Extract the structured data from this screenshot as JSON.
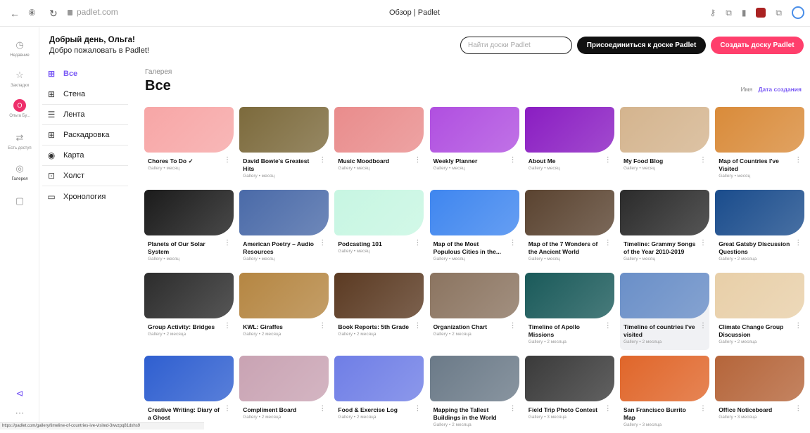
{
  "browser": {
    "url": "padlet.com",
    "window_title": "Обзор | Padlet",
    "status_url": "https://padlet.com/gallery/timeline-of-countries-ive-visited-3wvzpq81dxhs9"
  },
  "rail": {
    "items": [
      {
        "label": "Недавние",
        "icon": "clock-icon"
      },
      {
        "label": "Закладки",
        "icon": "star-icon"
      },
      {
        "label": "Ольга Бу...",
        "icon": "avatar",
        "avatar_letter": "О"
      },
      {
        "label": "Есть доступ",
        "icon": "share-icon"
      },
      {
        "label": "Галерея",
        "icon": "gallery-icon"
      },
      {
        "label": "",
        "icon": "add-board-icon"
      }
    ]
  },
  "greeting": {
    "title": "Добрый день, Ольга!",
    "subtitle": "Добро пожаловать в Padlet!"
  },
  "header": {
    "search_placeholder": "Найти доски Padlet",
    "join_label": "Присоединиться к доске Padlet",
    "create_label": "Создать доску Padlet"
  },
  "categories": [
    {
      "label": "Все",
      "icon": "grid-icon",
      "active": true
    },
    {
      "label": "Стена",
      "icon": "wall-icon"
    },
    {
      "label": "Лента",
      "icon": "stream-icon"
    },
    {
      "label": "Раскадровка",
      "icon": "storyboard-icon"
    },
    {
      "label": "Карта",
      "icon": "map-pin-icon"
    },
    {
      "label": "Холст",
      "icon": "canvas-icon"
    },
    {
      "label": "Хронология",
      "icon": "timeline-icon"
    }
  ],
  "gallery": {
    "breadcrumb": "Галерея",
    "title": "Все",
    "sort_name": "Имя",
    "sort_date": "Дата создания",
    "cards": [
      {
        "title": "Chores To Do ✓",
        "meta": "Gallery • месяц",
        "color": "#f7a6a6"
      },
      {
        "title": "David Bowie's Greatest Hits",
        "meta": "Gallery • месяц",
        "color": "#7c6a3c"
      },
      {
        "title": "Music Moodboard",
        "meta": "Gallery • месяц",
        "color": "#e98c8c"
      },
      {
        "title": "Weekly Planner",
        "meta": "Gallery • месяц",
        "color": "#b04fe0"
      },
      {
        "title": "About Me",
        "meta": "Gallery • месяц",
        "color": "#8a1dc2"
      },
      {
        "title": "My Food Blog",
        "meta": "Gallery • месяц",
        "color": "#d4b48e"
      },
      {
        "title": "Map of Countries I've Visited",
        "meta": "Gallery • месяц",
        "color": "#d98b3a"
      },
      {
        "title": "Planets of Our Solar System",
        "meta": "Gallery • месяц",
        "color": "#1b1b1b"
      },
      {
        "title": "American Poetry – Audio Resources",
        "meta": "Gallery • месяц",
        "color": "#4a6aa8"
      },
      {
        "title": "Podcasting 101",
        "meta": "Gallery • месяц",
        "color": "#c7f6e2"
      },
      {
        "title": "Map of the Most Populous Cities in the...",
        "meta": "Gallery • месяц",
        "color": "#3f86ef"
      },
      {
        "title": "Map of the 7 Wonders of the Ancient World",
        "meta": "Gallery • месяц",
        "color": "#5a4330"
      },
      {
        "title": "Timeline: Grammy Songs of the Year 2010-2019",
        "meta": "Gallery • месяц",
        "color": "#2b2b2b"
      },
      {
        "title": "Great Gatsby Discussion Questions",
        "meta": "Gallery • 2 месяца",
        "color": "#1a4c8c"
      },
      {
        "title": "Group Activity: Bridges",
        "meta": "Gallery • 2 месяца",
        "color": "#2c2c2c"
      },
      {
        "title": "KWL: Giraffes",
        "meta": "Gallery • 2 месяца",
        "color": "#b58642"
      },
      {
        "title": "Book Reports: 5th Grade",
        "meta": "Gallery • 2 месяца",
        "color": "#5b3a22"
      },
      {
        "title": "Organization Chart",
        "meta": "Gallery • 2 месяца",
        "color": "#8b7460"
      },
      {
        "title": "Timeline of Apollo Missions",
        "meta": "Gallery • 2 месяца",
        "color": "#1a5a5a"
      },
      {
        "title": "Timeline of countries I've visited",
        "meta": "Gallery • 2 месяца",
        "color": "#6a8fc8"
      },
      {
        "title": "Climate Change Group Discussion",
        "meta": "Gallery • 2 месяца",
        "color": "#e8cfa8"
      },
      {
        "title": "Creative Writing: Diary of a Ghost",
        "meta": "Gallery • 2 месяца",
        "color": "#2f5fd0"
      },
      {
        "title": "Compliment Board",
        "meta": "Gallery • 2 месяца",
        "color": "#c9a3b3"
      },
      {
        "title": "Food & Exercise Log",
        "meta": "Gallery • 2 месяца",
        "color": "#6f7ee6"
      },
      {
        "title": "Mapping the Tallest Buildings in the World",
        "meta": "Gallery • 2 месяца",
        "color": "#6b7a88"
      },
      {
        "title": "Field Trip Photo Contest",
        "meta": "Gallery • 3 месяца",
        "color": "#3a3a3a"
      },
      {
        "title": "San Francisco Burrito Map",
        "meta": "Gallery • 3 месяца",
        "color": "#e0662a"
      },
      {
        "title": "Office Noticeboard",
        "meta": "Gallery • 3 месяца",
        "color": "#b5653a"
      }
    ]
  },
  "highlighted_card_index": 19
}
